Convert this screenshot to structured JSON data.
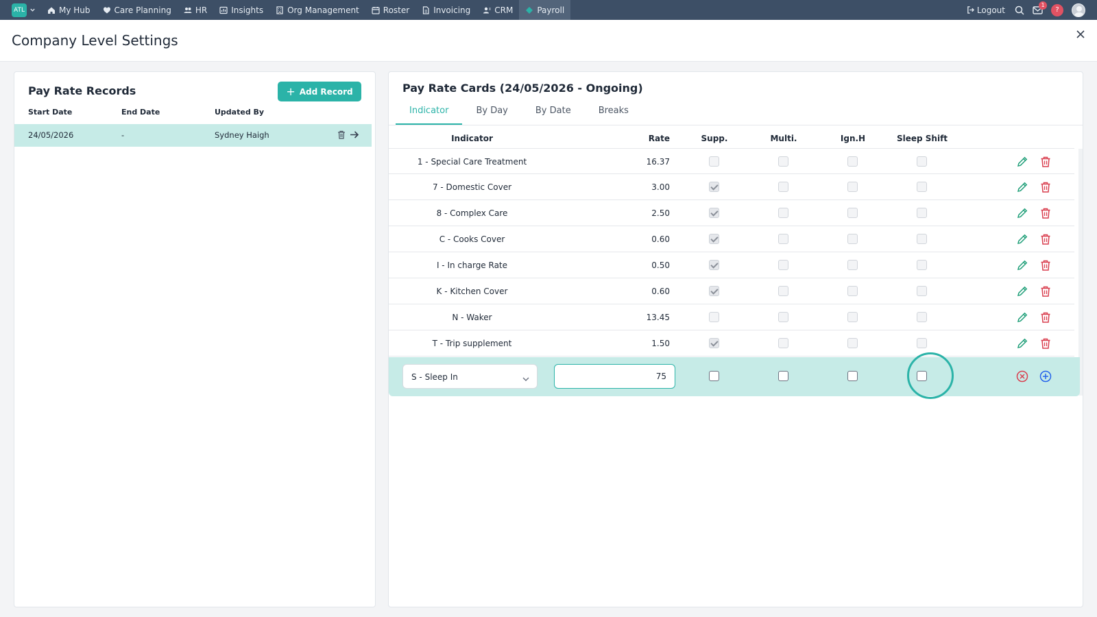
{
  "nav": {
    "brand": "ATL",
    "items": [
      {
        "label": "My Hub",
        "icon": "home-icon"
      },
      {
        "label": "Care Planning",
        "icon": "heart-icon"
      },
      {
        "label": "HR",
        "icon": "users-icon"
      },
      {
        "label": "Insights",
        "icon": "chart-icon"
      },
      {
        "label": "Org Management",
        "icon": "building-icon"
      },
      {
        "label": "Roster",
        "icon": "calendar-icon"
      },
      {
        "label": "Invoicing",
        "icon": "file-icon"
      },
      {
        "label": "CRM",
        "icon": "contacts-icon"
      },
      {
        "label": "Payroll",
        "icon": "diamond-icon",
        "active": true
      }
    ],
    "logout": "Logout",
    "mail_badge": "1",
    "help": "?"
  },
  "page": {
    "title": "Company Level Settings"
  },
  "records": {
    "title": "Pay Rate Records",
    "add_label": "Add Record",
    "columns": [
      "Start Date",
      "End Date",
      "Updated By"
    ],
    "rows": [
      {
        "start": "24/05/2026",
        "end": "-",
        "updated_by": "Sydney Haigh"
      }
    ]
  },
  "cards": {
    "title": "Pay Rate Cards (24/05/2026 - Ongoing)",
    "tabs": [
      "Indicator",
      "By Day",
      "By Date",
      "Breaks"
    ],
    "active_tab": "Indicator",
    "columns": {
      "indicator": "Indicator",
      "rate": "Rate",
      "supp": "Supp.",
      "multi": "Multi.",
      "ignh": "Ign.H",
      "sleep": "Sleep Shift"
    },
    "rows": [
      {
        "indicator": "1 - Special Care Treatment",
        "rate": "16.37",
        "supp": false,
        "multi": false,
        "ignh": false,
        "sleep": false
      },
      {
        "indicator": "7 - Domestic Cover",
        "rate": "3.00",
        "supp": true,
        "multi": false,
        "ignh": false,
        "sleep": false
      },
      {
        "indicator": "8 - Complex Care",
        "rate": "2.50",
        "supp": true,
        "multi": false,
        "ignh": false,
        "sleep": false
      },
      {
        "indicator": "C - Cooks Cover",
        "rate": "0.60",
        "supp": true,
        "multi": false,
        "ignh": false,
        "sleep": false
      },
      {
        "indicator": "I - In charge Rate",
        "rate": "0.50",
        "supp": true,
        "multi": false,
        "ignh": false,
        "sleep": false
      },
      {
        "indicator": "K - Kitchen Cover",
        "rate": "0.60",
        "supp": true,
        "multi": false,
        "ignh": false,
        "sleep": false
      },
      {
        "indicator": "N - Waker",
        "rate": "13.45",
        "supp": false,
        "multi": false,
        "ignh": false,
        "sleep": false
      },
      {
        "indicator": "T - Trip supplement",
        "rate": "1.50",
        "supp": true,
        "multi": false,
        "ignh": false,
        "sleep": false
      }
    ],
    "new_row": {
      "indicator": "S - Sleep In",
      "rate": "75"
    }
  },
  "colors": {
    "accent": "#2bb3a8",
    "nav": "#3d4f66",
    "danger": "#d93f4f",
    "row_highlight": "#c6ebe7"
  }
}
